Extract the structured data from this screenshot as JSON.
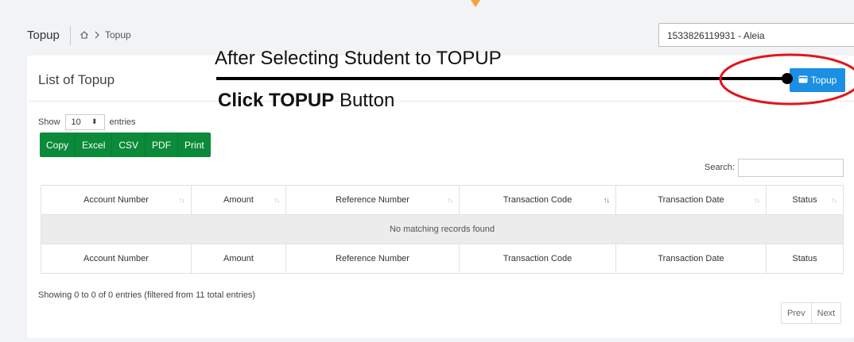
{
  "header": {
    "page_title": "Topup",
    "breadcrumb_current": "Topup",
    "student_select_value": "1533826119931 - Aleia"
  },
  "card": {
    "title": "List of Topup",
    "topup_button_label": "Topup",
    "length": {
      "show_label": "Show",
      "value": "10",
      "entries_label": "entries"
    },
    "export_buttons": [
      "Copy",
      "Excel",
      "CSV",
      "PDF",
      "Print"
    ],
    "search_label": "Search:",
    "table": {
      "columns": [
        "Account Number",
        "Amount",
        "Reference Number",
        "Transaction Code",
        "Transaction Date",
        "Status"
      ],
      "empty_message": "No matching records found"
    },
    "info_text": "Showing 0 to 0 of 0 entries (filtered from 11 total entries)",
    "pagination": {
      "prev": "Prev",
      "next": "Next"
    }
  },
  "annotation": {
    "line1": "After Selecting Student to TOPUP",
    "line2_bold": "Click TOPUP",
    "line2_rest": " Button",
    "highlight_color": "#e0151b"
  },
  "colors": {
    "primary": "#1a8fe3",
    "export_green": "#0b8a3a",
    "accent_orange": "#f7a13b"
  }
}
